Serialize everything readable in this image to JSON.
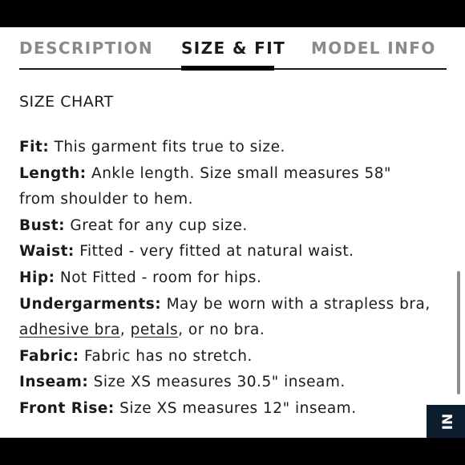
{
  "tabs": [
    {
      "label": "DESCRIPTION"
    },
    {
      "label": "SIZE & FIT"
    },
    {
      "label": "MODEL INFO"
    }
  ],
  "active_tab": "SIZE & FIT",
  "size_chart_link": "SIZE CHART",
  "details": {
    "fit": {
      "label": "Fit:",
      "text": " This garment fits true to size."
    },
    "length": {
      "label": "Length:",
      "text": " Ankle length. Size small measures 58\"",
      "text2": "from shoulder to hem."
    },
    "bust": {
      "label": "Bust:",
      "text": " Great for any cup size."
    },
    "waist": {
      "label": "Waist:",
      "text": " Fitted - very fitted at natural waist."
    },
    "hip": {
      "label": "Hip:",
      "text": " Not Fitted - room for hips."
    },
    "undergarments": {
      "label": "Undergarments:",
      "text": " May be worn with a strapless bra,",
      "link1": "adhesive bra",
      "sep": ", ",
      "link2": "petals",
      "text2": ", or no bra."
    },
    "fabric": {
      "label": "Fabric:",
      "text": " Fabric has no stretch."
    },
    "inseam": {
      "label": "Inseam:",
      "text": " Size XS measures 30.5\" inseam."
    },
    "front_rise": {
      "label": "Front Rise:",
      "text": " Size XS measures 12\" inseam."
    }
  },
  "corner_badge": "NI",
  "colors": {
    "accent": "#000000",
    "inactive_tab": "#8a8a8a",
    "badge_bg": "#0c1e2f"
  }
}
